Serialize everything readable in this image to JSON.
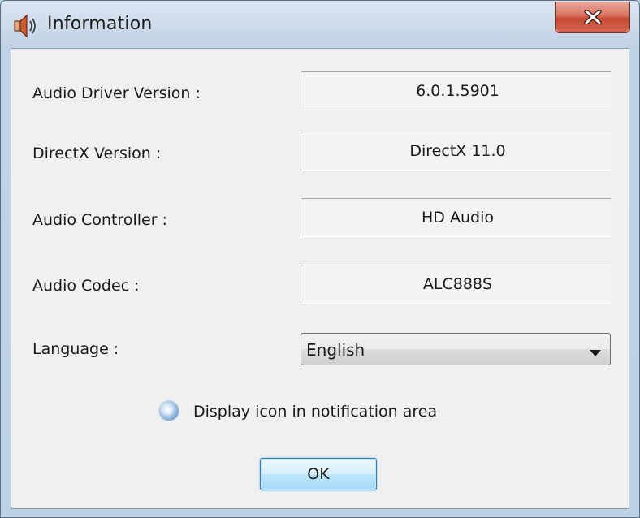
{
  "window": {
    "title": "Information",
    "close_label": "X"
  },
  "fields": [
    {
      "label": "Audio Driver Version :",
      "value": "6.0.1.5901"
    },
    {
      "label": "DirectX Version :",
      "value": "DirectX 11.0"
    },
    {
      "label": "Audio Controller :",
      "value": "HD Audio"
    },
    {
      "label": "Audio Codec :",
      "value": "ALC888S"
    }
  ],
  "language": {
    "label": "Language :",
    "selected": "English"
  },
  "notification": {
    "label": "Display icon in notification area"
  },
  "buttons": {
    "ok_label": "OK"
  },
  "colors": {
    "close_button": "#c44a33",
    "title_bar": "#c9d8e9",
    "client_bg": "#f0f0f0",
    "ok_button": "#bee6fd"
  }
}
